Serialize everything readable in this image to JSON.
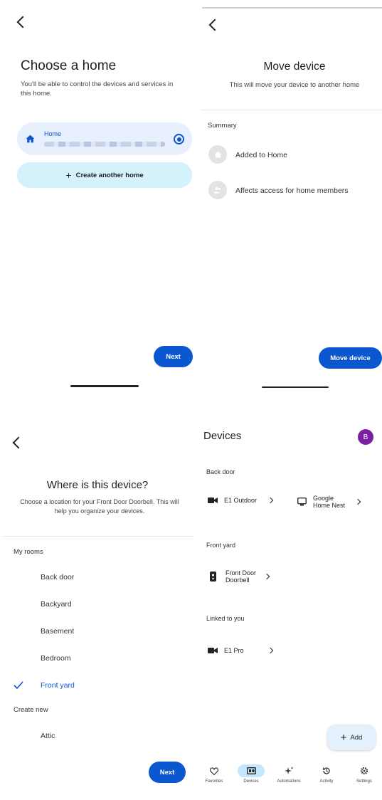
{
  "choose_home": {
    "title": "Choose a home",
    "subtitle": "You'll be able to control the devices and services in this home.",
    "home_option_label": "Home",
    "create_home_label": "Create another home",
    "next_label": "Next",
    "colors": {
      "accent": "#0b57d0",
      "selected_card": "#e8f0fe",
      "create_button": "#d3f2fb"
    }
  },
  "move_device": {
    "title": "Move device",
    "subtitle": "This will move your device to another home",
    "summary_heading": "Summary",
    "summary_items": [
      {
        "icon": "home-icon",
        "label": "Added to Home"
      },
      {
        "icon": "people-icon",
        "label": "Affects access for home members"
      }
    ],
    "move_label": "Move device"
  },
  "where_device": {
    "title": "Where is this device?",
    "subtitle": "Choose a location for your Front Door Doorbell. This will help you organize your devices.",
    "my_rooms_heading": "My rooms",
    "rooms": [
      {
        "label": "Back door",
        "selected": false
      },
      {
        "label": "Backyard",
        "selected": false
      },
      {
        "label": "Basement",
        "selected": false
      },
      {
        "label": "Bedroom",
        "selected": false
      },
      {
        "label": "Front yard",
        "selected": true
      }
    ],
    "create_new_heading": "Create new",
    "new_rooms": [
      {
        "label": "Attic"
      }
    ],
    "next_label": "Next"
  },
  "devices": {
    "title": "Devices",
    "avatar_letter": "B",
    "avatar_color": "#7b1fa2",
    "sections": [
      {
        "name": "Back door",
        "devices": [
          {
            "name": "E1 Outdoor",
            "icon": "camera-icon"
          },
          {
            "name": "Google Home Nest",
            "icon": "display-icon"
          }
        ]
      },
      {
        "name": "Front yard",
        "devices": [
          {
            "name": "Front Door Doorbell",
            "icon": "doorbell-icon"
          }
        ]
      },
      {
        "name": "Linked to you",
        "devices": [
          {
            "name": "E1 Pro",
            "icon": "camera-icon"
          }
        ]
      }
    ],
    "add_label": "Add",
    "nav": [
      {
        "label": "Favorites",
        "icon": "heart-icon",
        "active": false
      },
      {
        "label": "Devices",
        "icon": "devices-icon",
        "active": true
      },
      {
        "label": "Automations",
        "icon": "sparkle-icon",
        "active": false
      },
      {
        "label": "Activity",
        "icon": "history-icon",
        "active": false
      },
      {
        "label": "Settings",
        "icon": "gear-icon",
        "active": false
      }
    ]
  }
}
